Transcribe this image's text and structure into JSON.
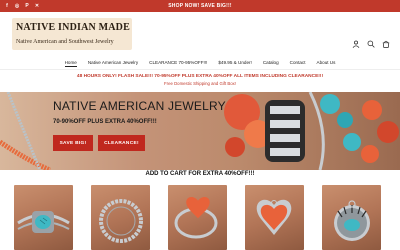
{
  "announcement": {
    "text": "SHOP NOW! SAVE BIG!!!"
  },
  "social": {
    "icons": [
      "facebook-icon",
      "instagram-icon",
      "pinterest-icon",
      "x-icon"
    ],
    "glyphs": [
      "f",
      "◎",
      "P",
      "✕"
    ]
  },
  "logo": {
    "line1": "NATIVE INDIAN MADE",
    "line2": "Native American and Southwest Jewelry"
  },
  "header_icons": [
    "account-icon",
    "search-icon",
    "cart-icon"
  ],
  "nav": {
    "items": [
      {
        "label": "Home",
        "active": true
      },
      {
        "label": "Native American Jewelry"
      },
      {
        "label": "CLEARANCE 70-95%OFF!!!"
      },
      {
        "label": "$49.95 & Under!"
      },
      {
        "label": "Catalog"
      },
      {
        "label": "Contact"
      },
      {
        "label": "About Us"
      }
    ]
  },
  "promo": {
    "line1": "48 HOURS ONLY! FLASH SALE!!! 70-95%OFF PLUS EXTRA 40%OFF ALL ITEMS INCLUDING CLEARANCE!!!",
    "line2": "Free Domestic Shipping and Gift Box!"
  },
  "hero": {
    "title": "NATIVE AMERICAN JEWELRY",
    "subtitle": "70-90%OFF PLUS EXTRA 40%OFF!!!",
    "buttons": [
      "SAVE BIG!",
      "CLEARANCE!"
    ]
  },
  "section": {
    "title": "ADD TO CART FOR EXTRA 40%OFF!!!"
  },
  "colors": {
    "accent": "#c0392b",
    "button": "#c0281e",
    "turquoise": "#3fb8c4",
    "coral": "#e8623a",
    "silver": "#c8ccd0"
  }
}
